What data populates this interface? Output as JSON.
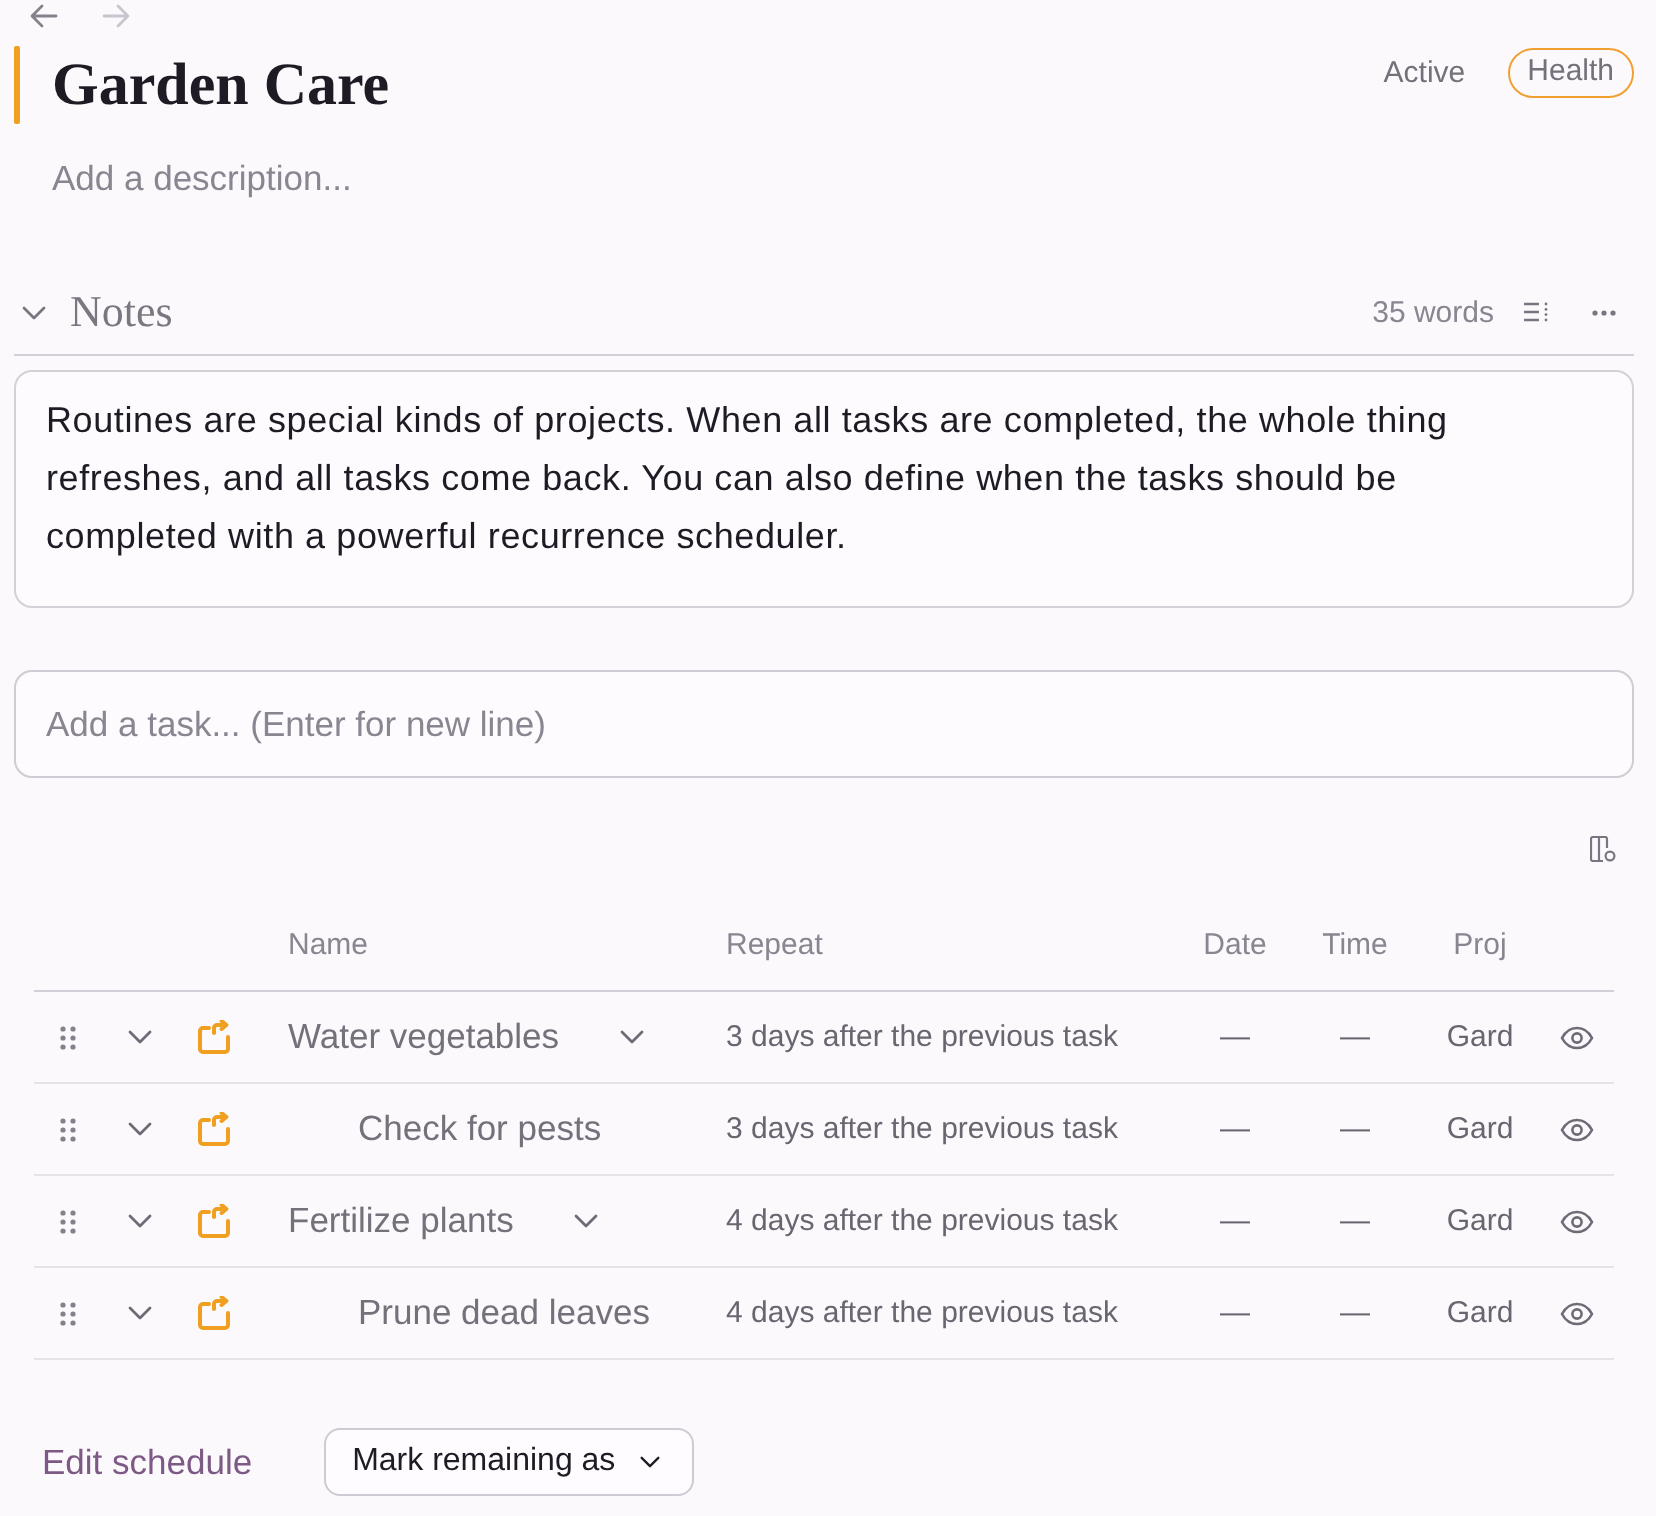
{
  "navigation": {
    "back": {
      "disabled": false
    },
    "forward": {
      "disabled": true
    }
  },
  "project": {
    "title": "Garden Care",
    "status": "Active",
    "tag": "Health",
    "description": {
      "placeholder": "Add a description..."
    }
  },
  "notes": {
    "title": "Notes",
    "expanded": true,
    "word_count": "35 words",
    "text": "Routines are special kinds of projects. When all tasks are completed, the whole thing refreshes, and all tasks come back. You can also define when the tasks should be completed with a powerful recurrence scheduler."
  },
  "task_input": {
    "placeholder": "Add a task... (Enter for new line)"
  },
  "table": {
    "columns": [
      "Name",
      "Repeat",
      "Date",
      "Time",
      "Proj"
    ],
    "rows": [
      {
        "name": "Water vegetables",
        "repeat": "3 days after the previous task",
        "date": "—",
        "time": "—",
        "project": "Gard",
        "expanded": true,
        "children": [
          {
            "name": "Check for pests",
            "repeat": "3 days after the previous task",
            "date": "—",
            "time": "—",
            "project": "Gard"
          }
        ]
      },
      {
        "name": "Fertilize plants",
        "repeat": "4 days after the previous task",
        "date": "—",
        "time": "—",
        "project": "Gard",
        "expanded": true,
        "children": [
          {
            "name": "Prune dead leaves",
            "repeat": "4 days after the previous task",
            "date": "—",
            "time": "—",
            "project": "Gard"
          }
        ]
      }
    ]
  },
  "footer": {
    "link": "Edit schedule",
    "button": "Mark remaining as"
  }
}
